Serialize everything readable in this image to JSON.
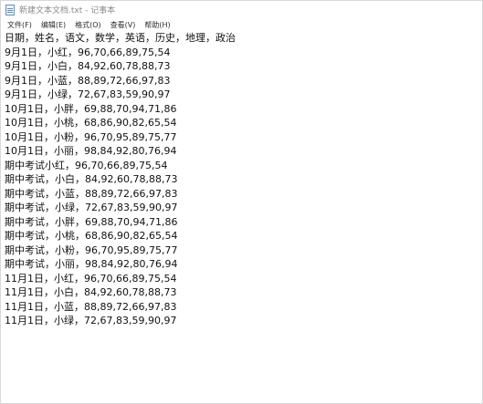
{
  "window": {
    "title": "新建文本文档.txt - 记事本"
  },
  "menu": {
    "items": [
      {
        "label": "文件(F)"
      },
      {
        "label": "编辑(E)"
      },
      {
        "label": "格式(O)"
      },
      {
        "label": "查看(V)"
      },
      {
        "label": "帮助(H)"
      }
    ]
  },
  "editor": {
    "lines": [
      "日期，姓名，语文，数学，英语，历史，地理，政治",
      "9月1日，小红，96,70,66,89,75,54",
      "9月1日，小白，84,92,60,78,88,73",
      "9月1日，小蓝，88,89,72,66,97,83",
      "9月1日，小绿，72,67,83,59,90,97",
      "10月1日，小胖，69,88,70,94,71,86",
      "10月1日，小桃，68,86,90,82,65,54",
      "10月1日，小粉，96,70,95,89,75,77",
      "10月1日，小丽，98,84,92,80,76,94",
      "期中考试小红，96,70,66,89,75,54",
      "期中考试，小白，84,92,60,78,88,73",
      "期中考试，小蓝，88,89,72,66,97,83",
      "期中考试，小绿，72,67,83,59,90,97",
      "期中考试，小胖，69,88,70,94,71,86",
      "期中考试，小桃，68,86,90,82,65,54",
      "期中考试，小粉，96,70,95,89,75,77",
      "期中考试，小丽，98,84,92,80,76,94",
      "11月1日，小红，96,70,66,89,75,54",
      "11月1日，小白，84,92,60,78,88,73",
      "11月1日，小蓝，88,89,72,66,97,83",
      "11月1日，小绿，72,67,83,59,90,97"
    ]
  }
}
